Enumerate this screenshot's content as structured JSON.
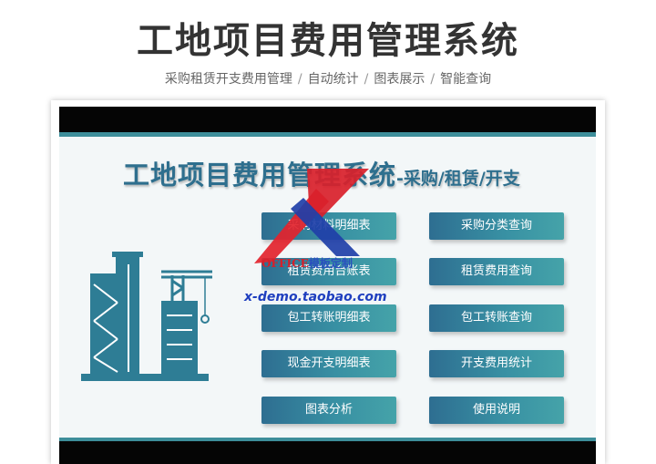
{
  "banner": {
    "title": "工地项目费用管理系统",
    "features": [
      "采购租赁开支费用管理",
      "自动统计",
      "图表展示",
      "智能查询"
    ],
    "separator": "/"
  },
  "app": {
    "heading": "工地项目费用管理系统",
    "heading_suffix": "-采购/租赁/开支"
  },
  "menu": {
    "left": [
      "采购材料明细表",
      "租赁费用台账表",
      "包工转账明细表",
      "现金开支明细表",
      "图表分析"
    ],
    "right": [
      "采购分类查询",
      "租赁费用查询",
      "包工转账查询",
      "开支费用统计",
      "使用说明"
    ]
  },
  "watermark": {
    "office": "OFFICE",
    "office_alt": "模板定制",
    "url": "x-demo.taobao.com"
  },
  "colors": {
    "accent": "#3d8e9a",
    "heading": "#2e6f8e",
    "button_start": "#2e6e91",
    "button_end": "#45a3a9",
    "bar": "#050505"
  }
}
